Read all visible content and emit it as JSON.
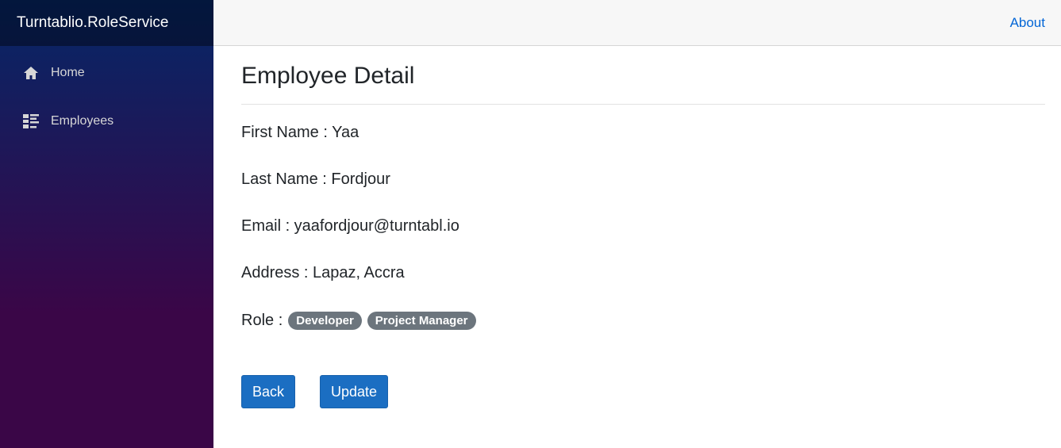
{
  "sidebar": {
    "brand": "Turntablio.RoleService",
    "items": [
      {
        "label": "Home",
        "icon": "home-icon"
      },
      {
        "label": "Employees",
        "icon": "list-icon"
      }
    ]
  },
  "topbar": {
    "about_label": "About"
  },
  "main": {
    "title": "Employee Detail",
    "fields": {
      "first_name": "First Name : Yaa",
      "last_name": "Last Name : Fordjour",
      "email": "Email : yaafordjour@turntabl.io",
      "address": "Address : Lapaz, Accra",
      "role_label": "Role :"
    },
    "roles": [
      "Developer",
      "Project Manager"
    ],
    "buttons": {
      "back": "Back",
      "update": "Update"
    }
  },
  "colors": {
    "sidebar_top": "#052767",
    "sidebar_bottom": "#3a0647",
    "primary_button": "#1b6ec2",
    "badge": "#6c757d",
    "link": "#0366d6"
  }
}
